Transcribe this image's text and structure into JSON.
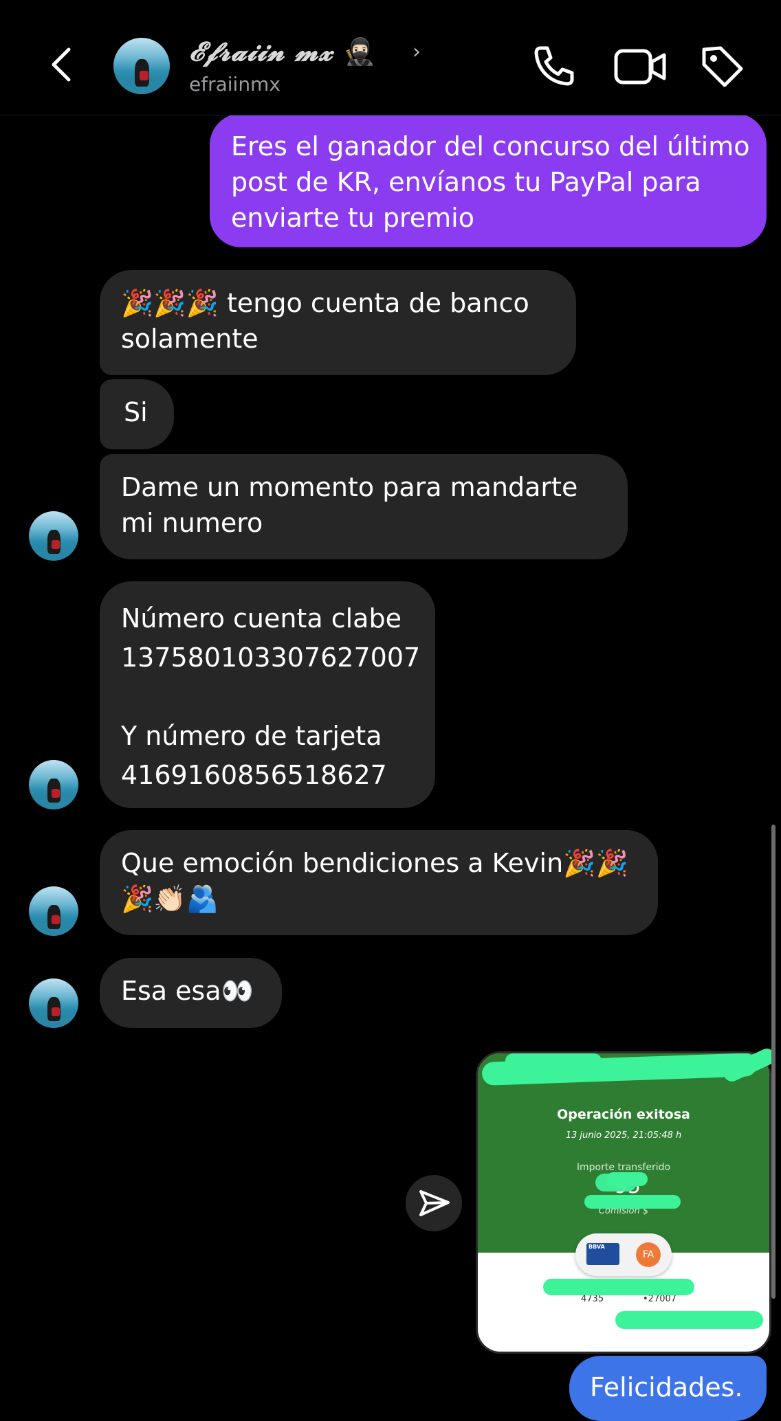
{
  "header": {
    "display_name": "𝓔𝓯𝓻𝓪𝓲𝓲𝓷 𝓶𝔁",
    "display_emoji": "🥷🏻",
    "username": "efraiinmx",
    "chevron": "›",
    "icons": [
      "back-arrow-icon",
      "phone-icon",
      "video-camera-icon",
      "tag-icon"
    ]
  },
  "messages": [
    {
      "from": "me",
      "text": "Eres el ganador del concurso del último post de KR, envíanos tu PayPal para enviarte tu premio"
    },
    {
      "from": "them",
      "text": "🎉🎉🎉 tengo cuenta de banco solamente"
    },
    {
      "from": "them",
      "text": "Si"
    },
    {
      "from": "them",
      "text": "Dame un momento para mandarte mi numero"
    },
    {
      "from": "them",
      "text": "Número cuenta clabe\n137580103307627007\n\nY número de tarjeta\n4169160856518627"
    },
    {
      "from": "them",
      "text": "Que emoción bendiciones a Kevin🎉🎉\n🎉👏🏻🫂"
    },
    {
      "from": "them",
      "text": "Esa esa👀"
    },
    {
      "from": "me",
      "text": "Felicidades."
    }
  ],
  "receipt": {
    "status": "Operación exitosa",
    "date": "13 junio 2025, 21:05:48 h",
    "amount_label": "Importe transferido",
    "amount_prefix": "$",
    "amount_visible": "95",
    "commission_label": "Comisión",
    "commission_prefix": "$",
    "bank_logo": "BBVA",
    "initials": "FA",
    "account_tail_left": "4735",
    "account_tail_right": "•27007"
  },
  "colors": {
    "background": "#000000",
    "bubble_them": "#262626",
    "bubble_me_purple": "#8b3cf0",
    "bubble_me_blue": "#3d74e8",
    "receipt_green": "#2e7d32",
    "scribble": "#3df39a"
  }
}
